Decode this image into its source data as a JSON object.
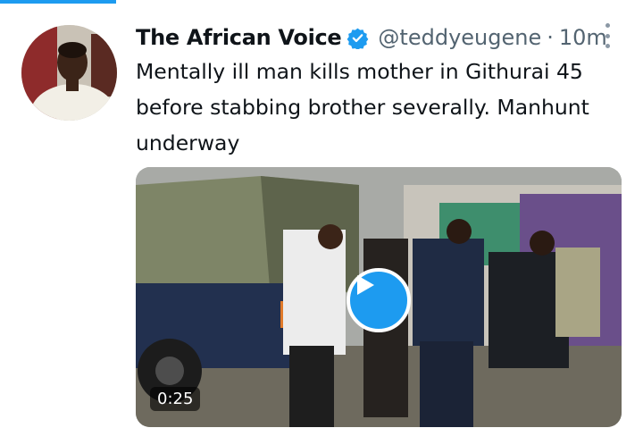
{
  "top_progress": {
    "fraction": 0.18,
    "color": "#1d9bf0"
  },
  "tweet": {
    "display_name": "The African Voice",
    "handle": "@teddyeugene",
    "separator": "·",
    "time": "10m",
    "text": "Mentally ill man kills mother in Githurai 45 before stabbing brother severally. Manhunt underway"
  },
  "icons": {
    "verified": "verified-badge-icon",
    "more": "more-vertical-icon",
    "play": "play-icon"
  },
  "video": {
    "duration": "0:25"
  },
  "colors": {
    "accent": "#1d9bf0",
    "text": "#0f1419",
    "secondary": "#536471"
  }
}
